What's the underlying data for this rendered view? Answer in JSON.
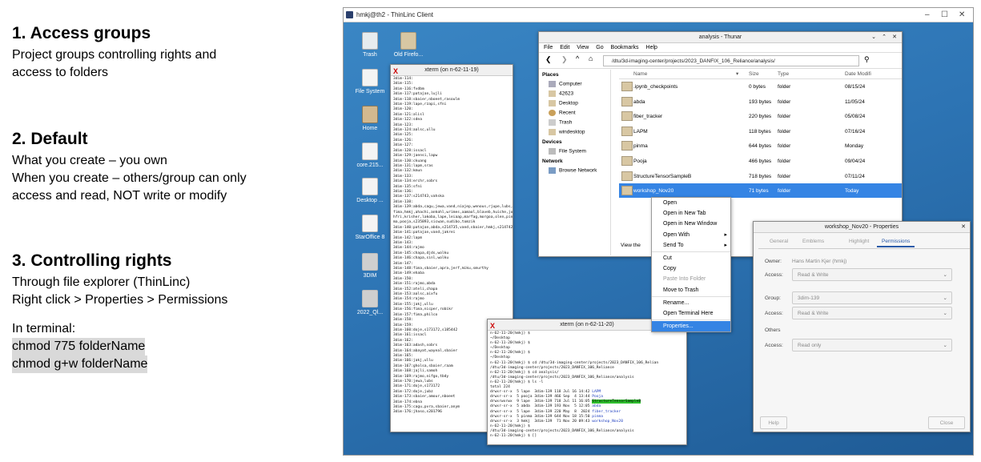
{
  "notes": {
    "s1_title": "1. Access groups",
    "s1_lines": [
      "Project groups controlling rights and",
      "access to folders"
    ],
    "s2_title": "2. Default",
    "s2_lines": [
      "What you create – you own",
      "When you create – others/group can only",
      "access and read, NOT write or modify"
    ],
    "s3_title": "3. Controlling rights",
    "s3_lines": [
      "Through file explorer (ThinLinc)",
      "Right click > Properties > Permissions"
    ],
    "terminal_label": "In terminal:",
    "commands": [
      "chmod 775 folderName",
      "chmod g+w folderName"
    ]
  },
  "client": {
    "title": "hmkj@th2 - ThinLinc Client",
    "controls": [
      "–",
      "☐",
      "✕"
    ]
  },
  "desktop_icons": [
    "Trash",
    "Old Firefo...",
    "File System",
    "Home",
    "core.215...",
    "Desktop ...",
    "StarOffice 8",
    "3DIM",
    "2022_Ql..."
  ],
  "xterm1": {
    "title": "xterm (on n-62-11-19)",
    "lines": [
      "3dim-114:",
      "3dim-115:",
      "3dim-116:fvdbm",
      "3dim-117:patajan,lujli",
      "3dim-118:sbaier,nboeet,rasoulm",
      "3dim-119:lape,rzapi,sfni",
      "3dim-120:",
      "3dim-121:alisl",
      "3dim-122:sdea",
      "3dim-123:",
      "3dim-124:aalsc,ullu",
      "3dim-125:",
      "3dim-126:",
      "3dim-127:",
      "3dim-128:issacl",
      "3dim-129:jaensi,lapw",
      "3dim-130:ckuang",
      "3dim-131:lapm,sras",
      "3dim-132:kmun",
      "3dim-133:",
      "3dim-134:erchr,sobrs",
      "3dim-135:sfni",
      "3dim-136:",
      "3dim-137:s214743,vahska",
      "3dim-138:",
      "3dim-139:abda,cagu,jewa,vand,niajep,wenous,rjupe,lubs,",
      "fima,hmkj,ahachi,ankohl,wrimes,aamaol,blaveb,huiche,jo",
      "hfri,krisher,lakoba,lape,leiaap,marfag,morgoa,olen,pin",
      "ma,pooja,s235893,sicwan,sudibo,tomzik",
      "3dim-140:patajan,abda,s214735,vand,sbaier,hmkj,s214742",
      "3dim-141:patajan,vand,jakrei",
      "3dim-142:lapm",
      "3dim-143:",
      "3dim-144:rajmo",
      "3dim-145:chapa,djds,wolku",
      "3dim-146:chapa,sinl,wolku",
      "3dim-147:",
      "3dim-148:fima,sbaier,apra,jerf,miku,smurthy",
      "3dim-149:ehaba",
      "3dim-150:",
      "3dim-151:rajmo,abda",
      "3dim-152:ateli,chapa",
      "3dim-153:aalsc,aixfu",
      "3dim-154:rajmo",
      "3dim-155:jakj,ullu",
      "3dim-156:fima,nicper,robikr",
      "3dim-157:fima,philco",
      "3dim-158:",
      "3dim-159:",
      "3dim-160:doje,s173172,s185442",
      "3dim-161:issacl",
      "3dim-162:",
      "3dim-163:adash,sobrs",
      "3dim-164:abayat,wayeal,sbaier",
      "3dim-165:",
      "3dim-166:jakj,ullu",
      "3dim-167:gholsa,sbaier,raam",
      "3dim-168:jajli,samoh",
      "3dim-169:rajmo,nifgo,tbdy",
      "3dim-170:jewa,lubs",
      "3dim-171:doje,s173172",
      "3dim-172:doje,jubz",
      "3dim-173:sbaier,amour,nboeet",
      "3dim-174:ebna",
      "3dim-175:cagu,pvra,sbaier,anym",
      "3dim-176:jhaso,s201796"
    ]
  },
  "xterm2": {
    "title": "xterm (on n-62-11-20)",
    "lines": [
      "n-62-11-20(hmkj) $",
      "~/Desktop",
      "n-62-11-20(hmkj) $",
      "~/Desktop",
      "n-62-11-20(hmkj) $",
      "~/Desktop",
      "n-62-11-20(hmkj) $ cd /dtu/3d-imaging-center/projects/2023_DANFIX_106_Relian",
      "/dtu/3d-imaging-center/projects/2023_DANFIX_106_Reliance",
      "n-62-11-20(hmkj) $ cd analysis/",
      "/dtu/3d-imaging-center/projects/2023_DANFIX_106_Reliance/analysis",
      "n-62-11-20(hmkj) $ ls -l",
      "total 224"
    ],
    "ls": [
      {
        "p": "drwxr-sr-x  5 lape  3dim-139 118 Jul 16 14:42 ",
        "n": "LAPM",
        "c": "#2040c0",
        "hl": false
      },
      {
        "p": "drwxr-sr-x  5 pooja 3dim-139 466 Sep  4 13:44 ",
        "n": "Pooja",
        "c": "#2040c0",
        "hl": false
      },
      {
        "p": "drwxrwxrwx  9 lape  3dim-139 718 Jul 11 16:05 ",
        "n": "StructureTensorSampleB",
        "c": "#2040c0",
        "hl": true
      },
      {
        "p": "drwxr-sr-x  5 abda  3dim-139 193 Nov  5 12:05 ",
        "n": "abda",
        "c": "#2040c0",
        "hl": false
      },
      {
        "p": "drwxr-sr-x  5 lape  3dim-139 220 May  8  2024 ",
        "n": "fiber_tracker",
        "c": "#2040c0",
        "hl": false
      },
      {
        "p": "drwxr-sr-x  5 pinma 3dim-139 644 Nov 18 15:50 ",
        "n": "pinma",
        "c": "#2040c0",
        "hl": false
      },
      {
        "p": "drwxr-sr-x  3 hmkj  3dim-139  71 Nov 20 09:43 ",
        "n": "workshop_Nov20",
        "c": "#2040c0",
        "hl": false
      }
    ],
    "tail": [
      "n-62-11-20(hmkj) $",
      "/dtu/3d-imaging-center/projects/2023_DANFIX_106_Reliance/analysis",
      "n-62-11-20(hmkj) $ []"
    ]
  },
  "thunar": {
    "title": "analysis - Thunar",
    "menu": [
      "File",
      "Edit",
      "View",
      "Go",
      "Bookmarks",
      "Help"
    ],
    "path": "/dtu/3d-imaging-center/projects/2023_DANFIX_106_Reliance/analysis/",
    "places_header": "Places",
    "places": [
      "Computer",
      "42623",
      "Desktop",
      "Recent",
      "Trash",
      "windesktop"
    ],
    "devices_header": "Devices",
    "devices": [
      "File System"
    ],
    "network_header": "Network",
    "network": [
      "Browse Network"
    ],
    "columns": [
      "Name",
      "Size",
      "Type",
      "Date Modifi"
    ],
    "rows": [
      {
        "name": ".ipynb_checkpoints",
        "size": "0 bytes",
        "type": "folder",
        "date": "08/15/24"
      },
      {
        "name": "abda",
        "size": "193 bytes",
        "type": "folder",
        "date": "11/05/24"
      },
      {
        "name": "fiber_tracker",
        "size": "220 bytes",
        "type": "folder",
        "date": "05/08/24"
      },
      {
        "name": "LAPM",
        "size": "118 bytes",
        "type": "folder",
        "date": "07/16/24"
      },
      {
        "name": "pinma",
        "size": "644 bytes",
        "type": "folder",
        "date": "Monday"
      },
      {
        "name": "Pooja",
        "size": "466 bytes",
        "type": "folder",
        "date": "09/04/24"
      },
      {
        "name": "StructureTensorSampleB",
        "size": "718 bytes",
        "type": "folder",
        "date": "07/11/24"
      },
      {
        "name": "workshop_Nov20",
        "size": "71 bytes",
        "type": "folder",
        "date": "Today"
      }
    ],
    "view_the": "View the"
  },
  "context_menu": [
    "Open",
    "Open in New Tab",
    "Open in New Window",
    "Open With",
    "Send To",
    "Cut",
    "Copy",
    "Paste Into Folder",
    "Move to Trash",
    "Rename...",
    "Open Terminal Here",
    "Properties..."
  ],
  "properties": {
    "title": "workshop_Nov20 - Properties",
    "tabs": [
      "General",
      "Emblems",
      "Highlight",
      "Permissions"
    ],
    "owner_label": "Owner:",
    "owner_value": "Hans Martin Kjer (hmkj)",
    "access_label": "Access:",
    "owner_access": "Read & Write",
    "group_label": "Group:",
    "group_value": "3dim-139",
    "group_access": "Read & Write",
    "others_label": "Others",
    "others_access": "Read only",
    "help": "Help",
    "close": "Close"
  }
}
